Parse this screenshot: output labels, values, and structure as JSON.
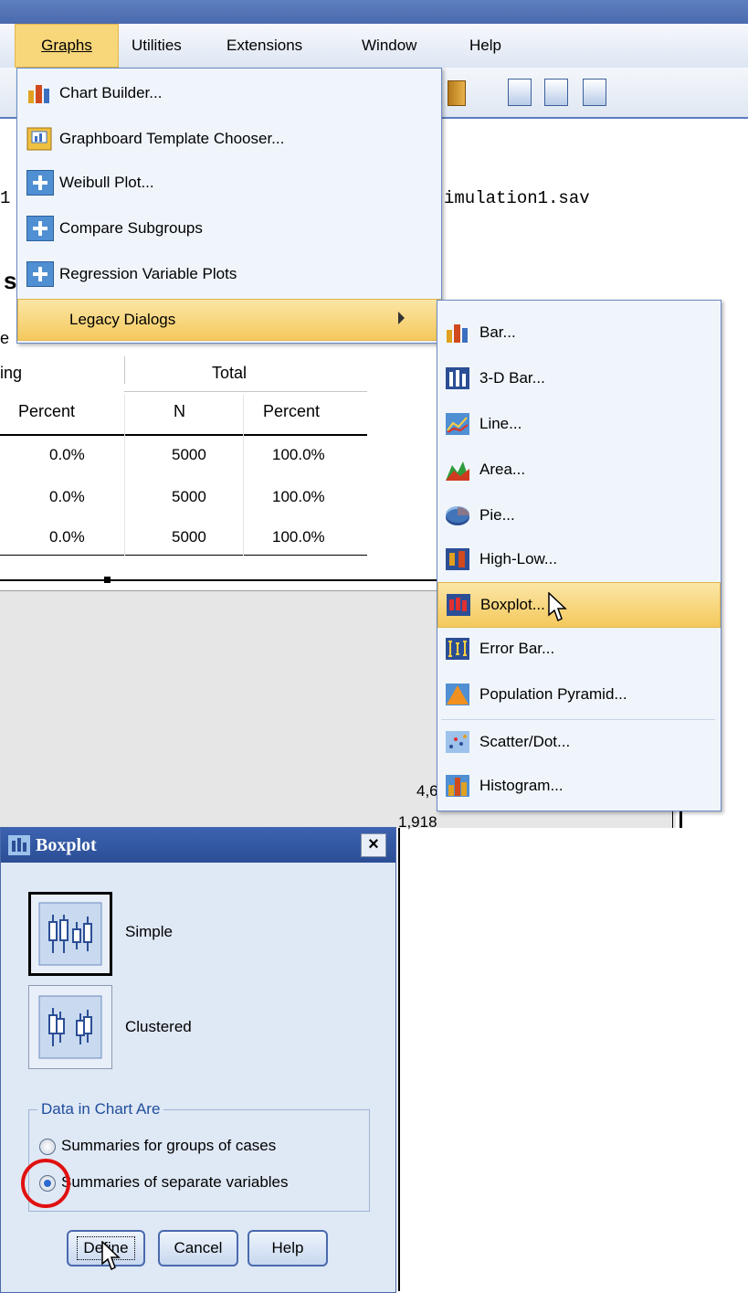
{
  "menubar": {
    "items": [
      "Graphs",
      "Utilities",
      "Extensions",
      "Window",
      "Help"
    ],
    "underline": [
      "G",
      "U",
      "x",
      "W",
      "H"
    ]
  },
  "background": {
    "file_text": "imulation1.sav",
    "cut_letter_s": "s",
    "cut_letter_e": "e",
    "cut_left_text": "1",
    "table": {
      "group_left": "ing",
      "group_right": "Total",
      "headers": [
        "Percent",
        "N",
        "Percent"
      ],
      "rows": [
        [
          "0.0%",
          "5000",
          "100.0%"
        ],
        [
          "0.0%",
          "5000",
          "100.0%"
        ],
        [
          "0.0%",
          "5000",
          "100.0%"
        ]
      ]
    },
    "plot_label_1": "4,6",
    "plot_label_2": "1,918"
  },
  "graphs_menu": {
    "items": [
      {
        "label": "Chart Builder...",
        "icon": "chart-builder-icon"
      },
      {
        "label": "Graphboard Template Chooser...",
        "icon": "graphboard-icon"
      },
      {
        "label": "Weibull Plot...",
        "icon": "plus-icon"
      },
      {
        "label": "Compare Subgroups",
        "icon": "plus-icon"
      },
      {
        "label": "Regression Variable Plots",
        "icon": "plus-icon"
      },
      {
        "label": "Legacy Dialogs",
        "icon": "",
        "has_submenu": true
      }
    ]
  },
  "legacy_submenu": {
    "items": [
      {
        "label": "Bar...",
        "icon": "bar-chart-icon"
      },
      {
        "label": "3-D Bar...",
        "icon": "3d-bar-icon"
      },
      {
        "label": "Line...",
        "icon": "line-chart-icon"
      },
      {
        "label": "Area...",
        "icon": "area-chart-icon"
      },
      {
        "label": "Pie...",
        "icon": "pie-chart-icon"
      },
      {
        "label": "High-Low...",
        "icon": "high-low-icon"
      },
      {
        "label": "Boxplot...",
        "icon": "boxplot-icon",
        "highlighted": true
      },
      {
        "label": "Error Bar...",
        "icon": "error-bar-icon"
      },
      {
        "label": "Population Pyramid...",
        "icon": "pyramid-icon"
      },
      {
        "label": "Scatter/Dot...",
        "icon": "scatter-icon"
      },
      {
        "label": "Histogram...",
        "icon": "histogram-icon"
      }
    ]
  },
  "dialog": {
    "title": "Boxplot",
    "close": "×",
    "options": [
      {
        "label": "Simple",
        "selected": true
      },
      {
        "label": "Clustered",
        "selected": false
      }
    ],
    "group_title": "Data in Chart Are",
    "radios": [
      {
        "label": "Summaries for groups of cases",
        "checked": false
      },
      {
        "label": "Summaries of separate variables",
        "checked": true
      }
    ],
    "buttons": [
      "Define",
      "Cancel",
      "Help"
    ]
  },
  "colors": {
    "menu_highlight": "#f7d77a",
    "annotation_circle": "#e01010",
    "dialog_title": "#2b4e95"
  }
}
